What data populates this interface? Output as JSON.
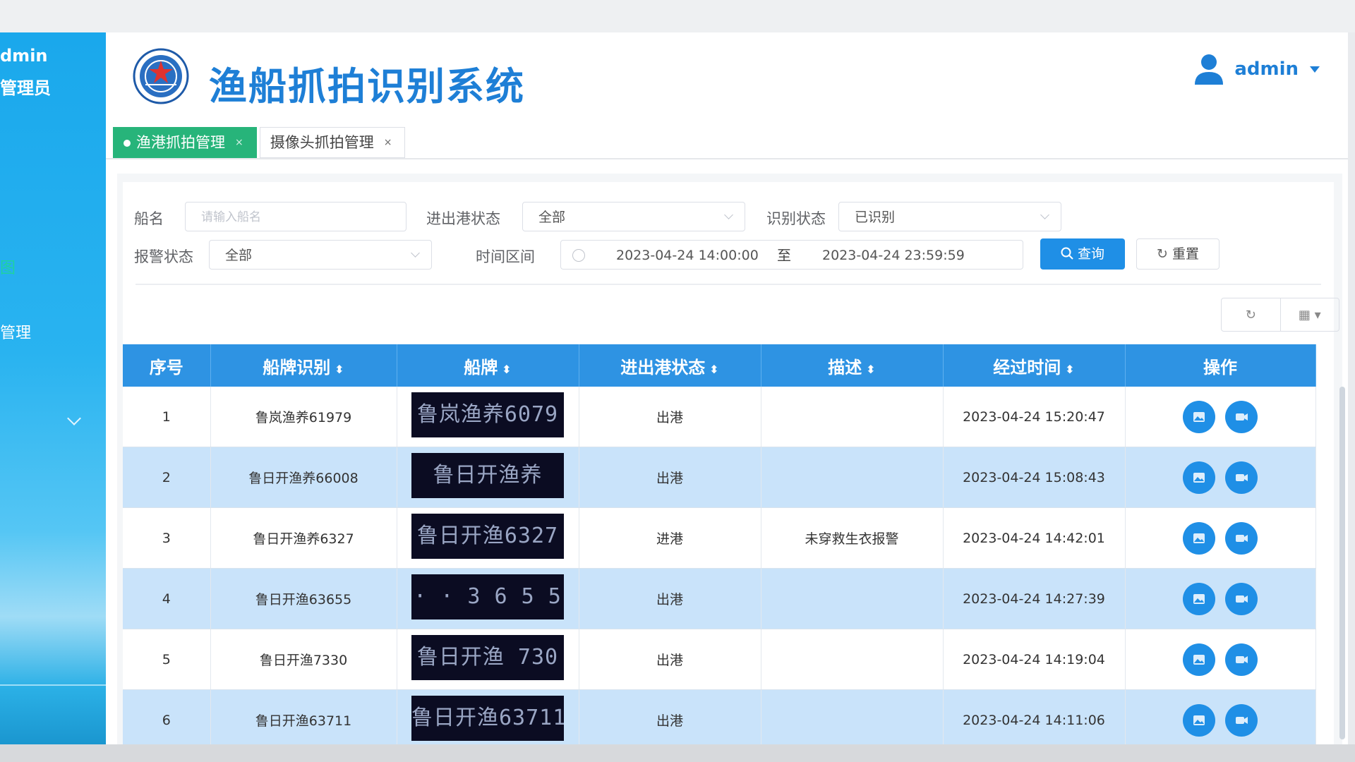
{
  "sidebar": {
    "user_line1": "dmin",
    "user_line2": "管理员",
    "items": [
      {
        "label": "图",
        "active": true
      },
      {
        "label": "管理",
        "active": false
      }
    ]
  },
  "header": {
    "title": "渔船抓拍识别系统",
    "user": "admin"
  },
  "tabs": [
    {
      "label": "渔港抓拍管理",
      "active": true
    },
    {
      "label": "摄像头抓拍管理",
      "active": false
    }
  ],
  "filters": {
    "ship_name_label": "船名",
    "ship_name_placeholder": "请输入船名",
    "port_status_label": "进出港状态",
    "port_status_value": "全部",
    "recog_status_label": "识别状态",
    "recog_status_value": "已识别",
    "alarm_status_label": "报警状态",
    "alarm_status_value": "全部",
    "time_range_label": "时间区间",
    "time_start": "2023-04-24 14:00:00",
    "time_sep": "至",
    "time_end": "2023-04-24 23:59:59",
    "query_button": "查询",
    "reset_button": "重置"
  },
  "table": {
    "columns": [
      "序号",
      "船牌识别",
      "船牌",
      "进出港状态",
      "描述",
      "经过时间",
      "操作"
    ],
    "rows": [
      {
        "index": "1",
        "recognized": "鲁岚渔养61979",
        "plate_text": "鲁岚渔养6079",
        "status": "出港",
        "desc": "",
        "time": "2023-04-24 15:20:47"
      },
      {
        "index": "2",
        "recognized": "鲁日开渔养66008",
        "plate_text": "鲁日开渔养",
        "status": "出港",
        "desc": "",
        "time": "2023-04-24 15:08:43"
      },
      {
        "index": "3",
        "recognized": "鲁日开渔养6327",
        "plate_text": "鲁日开渔6327",
        "status": "进港",
        "desc": "未穿救生衣报警",
        "time": "2023-04-24 14:42:01"
      },
      {
        "index": "4",
        "recognized": "鲁日开渔63655",
        "plate_text": "· · 3 6 5 5",
        "status": "出港",
        "desc": "",
        "time": "2023-04-24 14:27:39"
      },
      {
        "index": "5",
        "recognized": "鲁日开渔7330",
        "plate_text": "鲁日开渔 730",
        "status": "出港",
        "desc": "",
        "time": "2023-04-24 14:19:04"
      },
      {
        "index": "6",
        "recognized": "鲁日开渔63711",
        "plate_text": "鲁日开渔63711",
        "status": "出港",
        "desc": "",
        "time": "2023-04-24 14:11:06"
      }
    ]
  }
}
